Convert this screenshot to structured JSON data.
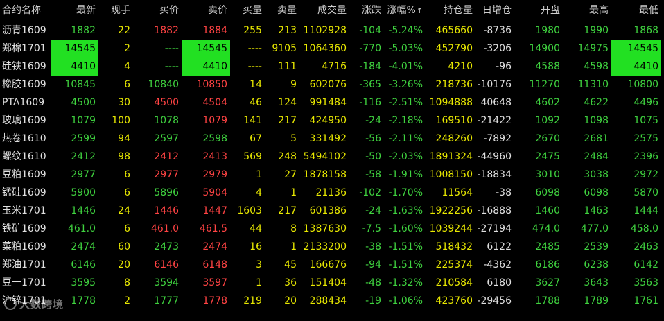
{
  "header": {
    "name": "合约名称",
    "last": "最新",
    "vol": "现手",
    "bid": "买价",
    "ask": "卖价",
    "bidq": "买量",
    "askq": "卖量",
    "total": "成交量",
    "chg": "涨跌",
    "pct": "涨幅%",
    "oi": "持仓量",
    "doi": "日增仓",
    "open": "开盘",
    "high": "最高",
    "low": "最低"
  },
  "rows": [
    {
      "name": "沥青1609",
      "last": "1882",
      "vol": "22",
      "bid": "1882",
      "ask": "1884",
      "bidq": "255",
      "askq": "213",
      "total": "1102928",
      "chg": "-104",
      "pct": "-5.24%",
      "oi": "465660",
      "doi": "-8736",
      "open": "1980",
      "high": "1990",
      "low": "1868"
    },
    {
      "name": "郑棉1701",
      "last": "14545",
      "vol": "2",
      "bid": "----",
      "ask": "14545",
      "bidq": "----",
      "askq": "9105",
      "total": "1064360",
      "chg": "-770",
      "pct": "-5.03%",
      "oi": "452790",
      "doi": "-3206",
      "open": "14900",
      "high": "14975",
      "low": "14545"
    },
    {
      "name": "硅铁1609",
      "last": "4410",
      "vol": "4",
      "bid": "----",
      "ask": "4410",
      "bidq": "----",
      "askq": "111",
      "total": "4716",
      "chg": "-184",
      "pct": "-4.01%",
      "oi": "4210",
      "doi": "-96",
      "open": "4588",
      "high": "4598",
      "low": "4410"
    },
    {
      "name": "橡胶1609",
      "last": "10845",
      "vol": "6",
      "bid": "10840",
      "ask": "10850",
      "bidq": "14",
      "askq": "9",
      "total": "602076",
      "chg": "-365",
      "pct": "-3.26%",
      "oi": "218736",
      "doi": "-10176",
      "open": "11270",
      "high": "11310",
      "low": "10800"
    },
    {
      "name": "PTA1609",
      "last": "4500",
      "vol": "30",
      "bid": "4500",
      "ask": "4504",
      "bidq": "46",
      "askq": "124",
      "total": "991484",
      "chg": "-116",
      "pct": "-2.51%",
      "oi": "1094888",
      "doi": "40648",
      "open": "4602",
      "high": "4622",
      "low": "4496"
    },
    {
      "name": "玻璃1609",
      "last": "1079",
      "vol": "100",
      "bid": "1078",
      "ask": "1079",
      "bidq": "141",
      "askq": "217",
      "total": "424950",
      "chg": "-24",
      "pct": "-2.18%",
      "oi": "169510",
      "doi": "-21422",
      "open": "1092",
      "high": "1098",
      "low": "1075"
    },
    {
      "name": "热卷1610",
      "last": "2599",
      "vol": "94",
      "bid": "2597",
      "ask": "2598",
      "bidq": "67",
      "askq": "5",
      "total": "331492",
      "chg": "-56",
      "pct": "-2.11%",
      "oi": "248260",
      "doi": "-7892",
      "open": "2670",
      "high": "2681",
      "low": "2575"
    },
    {
      "name": "螺纹1610",
      "last": "2412",
      "vol": "98",
      "bid": "2412",
      "ask": "2413",
      "bidq": "569",
      "askq": "248",
      "total": "5494102",
      "chg": "-50",
      "pct": "-2.03%",
      "oi": "1891324",
      "doi": "-44960",
      "open": "2475",
      "high": "2484",
      "low": "2396"
    },
    {
      "name": "豆粕1609",
      "last": "2977",
      "vol": "6",
      "bid": "2977",
      "ask": "2979",
      "bidq": "1",
      "askq": "27",
      "total": "1878158",
      "chg": "-58",
      "pct": "-1.91%",
      "oi": "1008150",
      "doi": "-18834",
      "open": "3010",
      "high": "3038",
      "low": "2972"
    },
    {
      "name": "锰硅1609",
      "last": "5900",
      "vol": "6",
      "bid": "5896",
      "ask": "5904",
      "bidq": "4",
      "askq": "1",
      "total": "21136",
      "chg": "-102",
      "pct": "-1.70%",
      "oi": "11564",
      "doi": "-38",
      "open": "6098",
      "high": "6098",
      "low": "5870"
    },
    {
      "name": "玉米1701",
      "last": "1446",
      "vol": "24",
      "bid": "1446",
      "ask": "1447",
      "bidq": "1603",
      "askq": "217",
      "total": "601386",
      "chg": "-24",
      "pct": "-1.63%",
      "oi": "1922256",
      "doi": "-16888",
      "open": "1460",
      "high": "1463",
      "low": "1444"
    },
    {
      "name": "铁矿1609",
      "last": "461.0",
      "vol": "6",
      "bid": "461.0",
      "ask": "461.5",
      "bidq": "44",
      "askq": "8",
      "total": "1387630",
      "chg": "-7.5",
      "pct": "-1.60%",
      "oi": "1039244",
      "doi": "-27194",
      "open": "474.0",
      "high": "477.0",
      "low": "458.0"
    },
    {
      "name": "菜粕1609",
      "last": "2474",
      "vol": "60",
      "bid": "2473",
      "ask": "2474",
      "bidq": "16",
      "askq": "1",
      "total": "2133200",
      "chg": "-38",
      "pct": "-1.51%",
      "oi": "518432",
      "doi": "6122",
      "open": "2485",
      "high": "2539",
      "low": "2463"
    },
    {
      "name": "郑油1701",
      "last": "6146",
      "vol": "20",
      "bid": "6146",
      "ask": "6148",
      "bidq": "3",
      "askq": "45",
      "total": "166676",
      "chg": "-94",
      "pct": "-1.51%",
      "oi": "225374",
      "doi": "-4362",
      "open": "6186",
      "high": "6238",
      "low": "6142"
    },
    {
      "name": "豆一1701",
      "last": "3595",
      "vol": "8",
      "bid": "3594",
      "ask": "3597",
      "bidq": "1",
      "askq": "36",
      "total": "151404",
      "chg": "-48",
      "pct": "-1.32%",
      "oi": "210584",
      "doi": "6180",
      "open": "3627",
      "high": "3643",
      "low": "3563"
    },
    {
      "name": "沪锌1701",
      "last": "1778",
      "vol": "2",
      "bid": "1777",
      "ask": "1778",
      "bidq": "219",
      "askq": "20",
      "total": "288434",
      "chg": "-19",
      "pct": "-1.06%",
      "oi": "423760",
      "doi": "-29456",
      "open": "1788",
      "high": "1789",
      "low": "1761"
    }
  ],
  "watermark": "大数跨境",
  "sort_indicator": "↑",
  "colors": {
    "down": "#3fd23f",
    "up": "#ff4343",
    "volume": "#e8e800",
    "neutral": "#e0e0e0",
    "limit_bg": "#22e022"
  }
}
